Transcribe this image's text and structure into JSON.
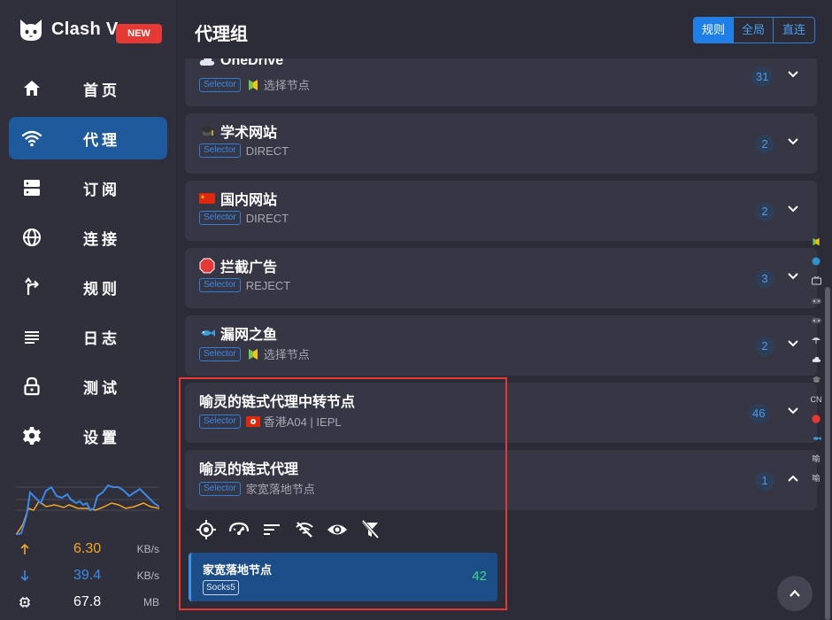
{
  "app": {
    "name": "Clash V",
    "badge": "NEW"
  },
  "sidebar": {
    "items": [
      {
        "label": "首页",
        "icon": "home-icon"
      },
      {
        "label": "代理",
        "icon": "wifi-icon",
        "active": true
      },
      {
        "label": "订阅",
        "icon": "server-icon"
      },
      {
        "label": "连接",
        "icon": "globe-icon"
      },
      {
        "label": "规则",
        "icon": "fork-icon"
      },
      {
        "label": "日志",
        "icon": "list-icon"
      },
      {
        "label": "测试",
        "icon": "lock-icon"
      },
      {
        "label": "设置",
        "icon": "gear-icon"
      }
    ]
  },
  "traffic": {
    "upload": {
      "value": "6.30",
      "unit": "KB/s",
      "color": "#f5a623"
    },
    "download": {
      "value": "39.4",
      "unit": "KB/s",
      "color": "#3a8ae6"
    },
    "memory": {
      "value": "67.8",
      "unit": "MB"
    }
  },
  "header": {
    "title": "代理组",
    "modes": [
      "规则",
      "全局",
      "直连"
    ],
    "active_mode": "规则"
  },
  "groups": [
    {
      "name": "OneDrive",
      "emoji": "cloud-icon",
      "type": "Selector",
      "selected": "选择节点",
      "selected_icon": "shield-badge-icon",
      "count": "31",
      "expanded": false
    },
    {
      "name": "学术网站",
      "emoji": "graduation-cap-icon",
      "type": "Selector",
      "selected": "DIRECT",
      "count": "2",
      "expanded": false
    },
    {
      "name": "国内网站",
      "emoji": "china-flag-icon",
      "type": "Selector",
      "selected": "DIRECT",
      "count": "2",
      "expanded": false
    },
    {
      "name": "拦截广告",
      "emoji": "stop-sign-icon",
      "type": "Selector",
      "selected": "REJECT",
      "count": "3",
      "expanded": false
    },
    {
      "name": "漏网之鱼",
      "emoji": "fish-icon",
      "type": "Selector",
      "selected": "选择节点",
      "selected_icon": "shield-badge-icon",
      "count": "2",
      "expanded": false
    },
    {
      "name": "喻灵的链式代理中转节点",
      "emoji": "",
      "type": "Selector",
      "selected": "香港A04 | IEPL",
      "selected_icon": "hk-flag-icon",
      "count": "46",
      "expanded": false
    },
    {
      "name": "喻灵的链式代理",
      "emoji": "",
      "type": "Selector",
      "selected": "家宽落地节点",
      "count": "1",
      "expanded": true
    }
  ],
  "tools": [
    "locate-icon",
    "speed-test-icon",
    "sort-icon",
    "filter-off-icon",
    "eye-icon",
    "funnel-off-icon"
  ],
  "proxy_node": {
    "name": "家宽落地节点",
    "type": "Socks5",
    "delay": "42"
  },
  "side_index": [
    "shield-badge-icon",
    "globe-icon",
    "tv-icon",
    "gamepad-icon",
    "gamepad-icon",
    "umbrella-icon",
    "cloud-icon",
    "graduation-cap-icon",
    "CN",
    "stop-sign-icon",
    "fish-icon",
    "喻",
    "喻"
  ]
}
